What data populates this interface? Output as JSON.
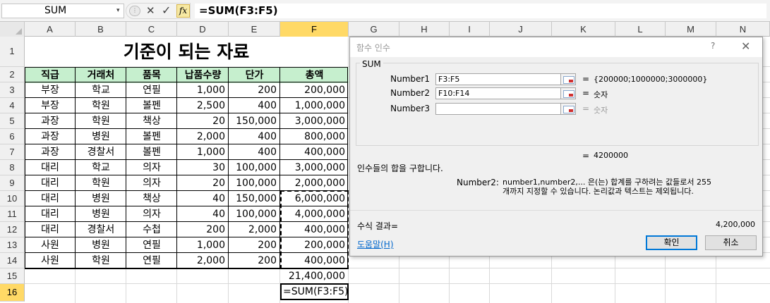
{
  "formula_bar": {
    "name_box": "SUM",
    "name_box_arrow": "▾",
    "cancel_icon": "✕",
    "enter_icon": "✓",
    "fx_label": "fx",
    "formula": "=SUM(F3:F5)"
  },
  "columns": [
    "A",
    "B",
    "C",
    "D",
    "E",
    "F",
    "G",
    "H",
    "I",
    "J",
    "K",
    "L",
    "M",
    "N"
  ],
  "rows": [
    "1",
    "2",
    "3",
    "4",
    "5",
    "6",
    "7",
    "8",
    "9",
    "10",
    "11",
    "12",
    "13",
    "14",
    "15",
    "16"
  ],
  "selected_column": "F",
  "selected_row": "16",
  "sheet": {
    "title": "기준이 되는 자료",
    "headers": [
      "직급",
      "거래처",
      "품목",
      "납품수량",
      "단가",
      "총액"
    ],
    "header_fill": "#c6efce",
    "data": [
      [
        "부장",
        "학교",
        "연필",
        "1,000",
        "200",
        "200,000"
      ],
      [
        "부장",
        "학원",
        "볼펜",
        "2,500",
        "400",
        "1,000,000"
      ],
      [
        "과장",
        "학원",
        "책상",
        "20",
        "150,000",
        "3,000,000"
      ],
      [
        "과장",
        "병원",
        "볼펜",
        "2,000",
        "400",
        "800,000"
      ],
      [
        "과장",
        "경찰서",
        "볼펜",
        "1,000",
        "400",
        "400,000"
      ],
      [
        "대리",
        "학교",
        "의자",
        "30",
        "100,000",
        "3,000,000"
      ],
      [
        "대리",
        "학원",
        "의자",
        "20",
        "100,000",
        "2,000,000"
      ],
      [
        "대리",
        "병원",
        "책상",
        "40",
        "150,000",
        "6,000,000"
      ],
      [
        "대리",
        "병원",
        "의자",
        "40",
        "100,000",
        "4,000,000"
      ],
      [
        "대리",
        "경찰서",
        "수첩",
        "200",
        "2,000",
        "400,000"
      ],
      [
        "사원",
        "병원",
        "연필",
        "1,000",
        "200",
        "200,000"
      ],
      [
        "사원",
        "학원",
        "연필",
        "2,000",
        "200",
        "400,000"
      ]
    ],
    "total": "21,400,000",
    "active_cell": "=SUM(F3:F5)"
  },
  "dialog": {
    "title": "함수 인수",
    "help_icon": "?",
    "close_icon": "✕",
    "function_name": "SUM",
    "args": [
      {
        "label": "Number1",
        "value": "F3:F5",
        "eq": "=",
        "result": "{200000;1000000;3000000}"
      },
      {
        "label": "Number2",
        "value": "F10:F14",
        "eq": "=",
        "result": "숫자"
      },
      {
        "label": "Number3",
        "value": "",
        "eq": "=",
        "result": "숫자"
      }
    ],
    "result_eq": "=",
    "result": "4200000",
    "description": "인수들의 합을 구합니다.",
    "arg_desc_label": "Number2:",
    "arg_desc": "number1,number2,... 은(는) 합계를 구하려는 값들로서 255개까지 지정할 수 있습니다. 논리값과 텍스트는 제외됩니다.",
    "formula_result_label": "수식 결과=",
    "formula_result": "4,200,000",
    "help_link": "도움말(H)",
    "ok_label": "확인",
    "cancel_label": "취소"
  }
}
